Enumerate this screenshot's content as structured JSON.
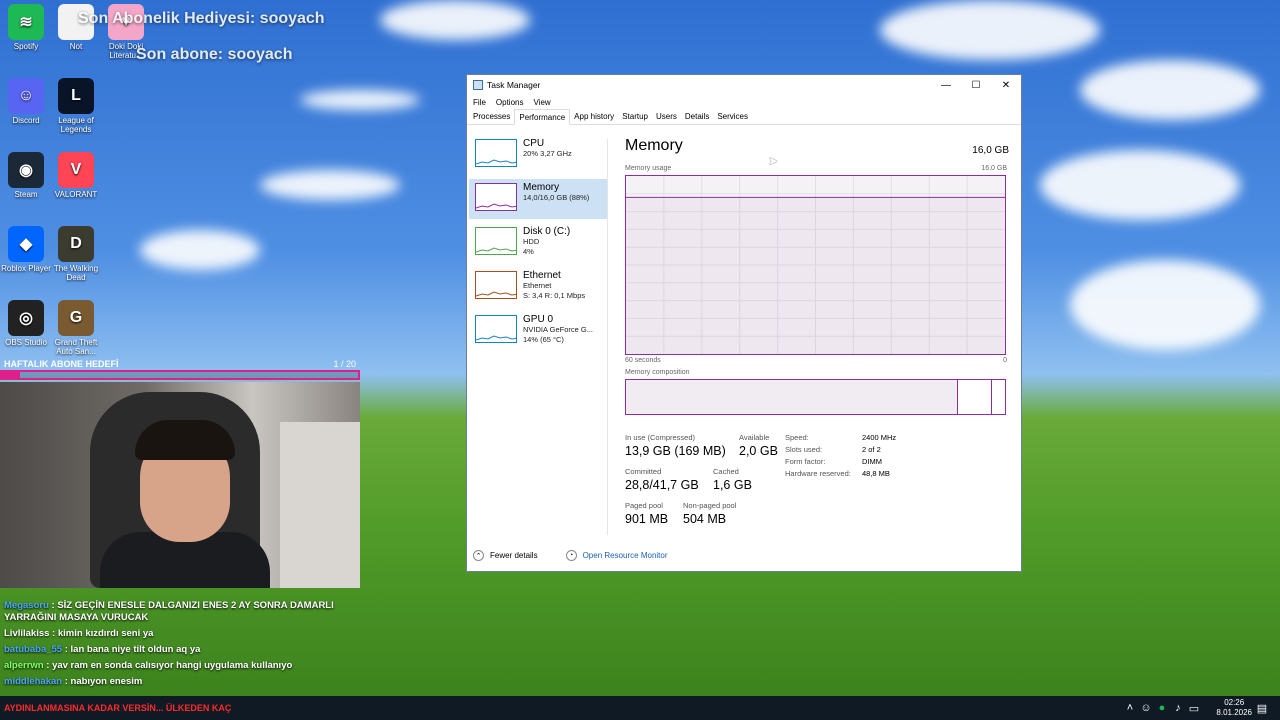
{
  "desktop": {
    "icons": [
      {
        "label": "Spotify",
        "color": "#1db954",
        "glyph": "≋"
      },
      {
        "label": "Not",
        "color": "#f2f2f2",
        "glyph": ""
      },
      {
        "label": "Doki Doki Literatu...",
        "color": "#f4a6c8",
        "glyph": "♥"
      },
      {
        "label": "Discord",
        "color": "#5865f2",
        "glyph": "☺"
      },
      {
        "label": "League of Legends",
        "color": "#0a1428",
        "glyph": "L"
      },
      {
        "label": "Steam",
        "color": "#1b2838",
        "glyph": "◉"
      },
      {
        "label": "VALORANT",
        "color": "#fd4556",
        "glyph": "V"
      },
      {
        "label": "Roblox Player",
        "color": "#0066ff",
        "glyph": "◆"
      },
      {
        "label": "The Walking Dead",
        "color": "#3b3b30",
        "glyph": "D"
      },
      {
        "label": "OBS Studio",
        "color": "#222",
        "glyph": "◎"
      },
      {
        "label": "Grand Theft Auto San...",
        "color": "#7a5a30",
        "glyph": "G"
      }
    ],
    "overlay_line1": "Son Abonelik Hediyesi: sooyach",
    "overlay_line2": "Son abone: sooyach"
  },
  "stream": {
    "goal_label": "HAFTALIK ABONE HEDEFİ",
    "goal_count": "1 / 20",
    "goal_progress": 0.05,
    "chat": [
      {
        "user": "Megasoru",
        "user_color": "#4aa3ff",
        "text": "SİZ GEÇİN ENESLE DALGANIZI ENES 2 AY SONRA DAMARLI YARRAĞINI MASAYA VURUCAK"
      },
      {
        "user": "Livlilakiss",
        "user_color": "#ffffff",
        "text": "kimin kızdırdı seni ya"
      },
      {
        "user": "batubaba_55",
        "user_color": "#4aa3ff",
        "text": "lan bana niye tilt oldun aq ya"
      },
      {
        "user": "alperrwn",
        "user_color": "#7fff6a",
        "text": "yav ram en sonda calısıyor hangi uygulama kullanıyo"
      },
      {
        "user": "middlehakan",
        "user_color": "#4aa3ff",
        "text": "nabıyon enesim"
      }
    ],
    "ticker": "AYDINLANMASINA KADAR VERSİN... ÜLKEDEN KAÇ"
  },
  "taskmanager": {
    "title": "Task Manager",
    "menu": [
      "File",
      "Options",
      "View"
    ],
    "tabs": [
      "Processes",
      "Performance",
      "App history",
      "Startup",
      "Users",
      "Details",
      "Services"
    ],
    "active_tab": "Performance",
    "sidebar": [
      {
        "name": "CPU",
        "sub1": "20%  3,27 GHz",
        "sub2": "",
        "color": "#1182c8"
      },
      {
        "name": "Memory",
        "sub1": "14,0/16,0 GB (88%)",
        "sub2": "",
        "color": "#8b2e9e"
      },
      {
        "name": "Disk 0 (C:)",
        "sub1": "HDD",
        "sub2": "4%",
        "color": "#4ca64c"
      },
      {
        "name": "Ethernet",
        "sub1": "Ethernet",
        "sub2": "S: 3,4  R: 0,1 Mbps",
        "color": "#a74f1c"
      },
      {
        "name": "GPU 0",
        "sub1": "NVIDIA GeForce G...",
        "sub2": "14%  (65 °C)",
        "color": "#1182c8"
      }
    ],
    "memory": {
      "title": "Memory",
      "total": "16,0 GB",
      "usage_label": "Memory usage",
      "usage_max": "16,0 GB",
      "axis_left": "60 seconds",
      "axis_right": "0",
      "composition_label": "Memory composition",
      "usage_fraction": 0.88,
      "composition_in_use": 0.877,
      "composition_standby": 0.12,
      "in_use_label": "In use (Compressed)",
      "in_use_value": "13,9 GB (169 MB)",
      "available_label": "Available",
      "available_value": "2,0 GB",
      "committed_label": "Committed",
      "committed_value": "28,8/41,7 GB",
      "cached_label": "Cached",
      "cached_value": "1,6 GB",
      "paged_label": "Paged pool",
      "paged_value": "901 MB",
      "nonpaged_label": "Non-paged pool",
      "nonpaged_value": "504 MB",
      "speed_label": "Speed:",
      "speed_value": "2400 MHz",
      "slots_label": "Slots used:",
      "slots_value": "2 of 2",
      "form_label": "Form factor:",
      "form_value": "DIMM",
      "reserved_label": "Hardware reserved:",
      "reserved_value": "48,8 MB"
    },
    "footer": {
      "fewer": "Fewer details",
      "monitor": "Open Resource Monitor"
    }
  },
  "taskbar": {
    "time": "02:26",
    "date": "8.01.2026"
  }
}
